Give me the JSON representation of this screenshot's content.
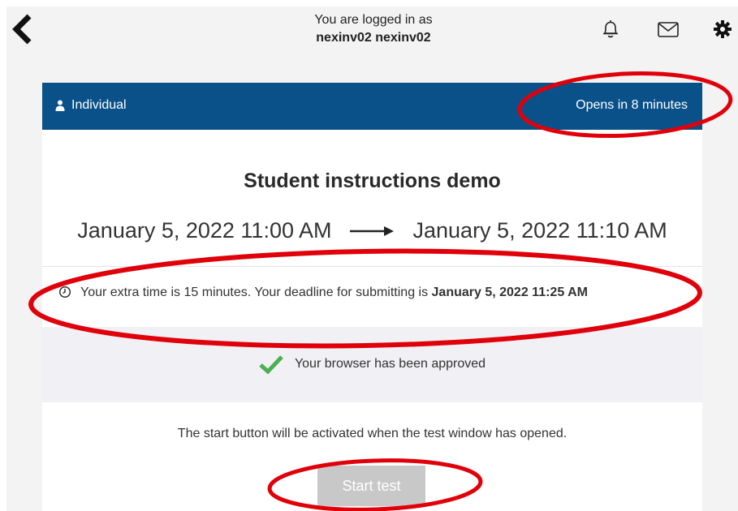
{
  "topbar": {
    "logged_in_label": "You are logged in as",
    "username": "nexinv02 nexinv02",
    "icons": [
      "back-chevron-icon",
      "bell-icon",
      "mail-icon",
      "gear-icon"
    ]
  },
  "card": {
    "header": {
      "mode_label": "Individual",
      "mode_icon": "person-icon",
      "status": "Opens in 8 minutes",
      "color": "#0a5189"
    },
    "title": "Student instructions demo",
    "start_time": "January 5, 2022 11:00 AM",
    "end_time": "January 5, 2022 11:10 AM",
    "extra_time_text": "Your extra time is 15 minutes. Your deadline for submitting is ",
    "extra_time_deadline": "January 5, 2022 11:25 AM",
    "browser_status": "Your browser has been approved",
    "start_note": "The start button will be activated when the test window has opened.",
    "start_button_label": "Start test",
    "accent_check_color": "#4caf50",
    "annotation_color": "#e0000a"
  }
}
